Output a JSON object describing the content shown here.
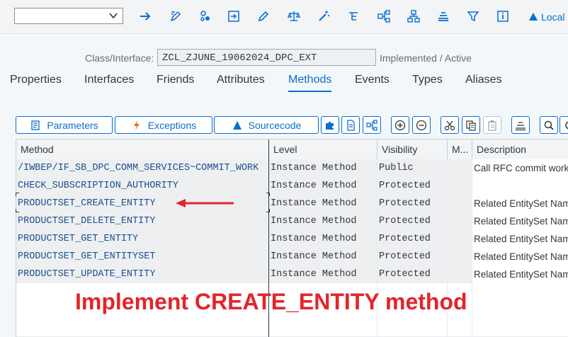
{
  "toolbar": {
    "combo_value": "",
    "icons": [
      "arrow-right-icon",
      "edit-display-icon",
      "object-list-icon",
      "where-used-icon",
      "pencil-icon",
      "balance-icon",
      "magic-wand-icon",
      "hierarchy-icon",
      "flow-icon",
      "org-chart-icon",
      "stack-icon",
      "filter-icon",
      "info-icon"
    ],
    "local_label": "Local"
  },
  "class_interface": {
    "label": "Class/Interface:",
    "value": "ZCL_ZJUNE_19062024_DPC_EXT",
    "status": "Implemented / Active"
  },
  "tabs": [
    {
      "label": "Properties",
      "active": false
    },
    {
      "label": "Interfaces",
      "active": false
    },
    {
      "label": "Friends",
      "active": false
    },
    {
      "label": "Attributes",
      "active": false
    },
    {
      "label": "Methods",
      "active": true
    },
    {
      "label": "Events",
      "active": false
    },
    {
      "label": "Types",
      "active": false
    },
    {
      "label": "Aliases",
      "active": false
    }
  ],
  "method_toolbar": {
    "parameters": "Parameters",
    "exceptions": "Exceptions",
    "sourcecode": "Sourcecode"
  },
  "grid": {
    "headers": {
      "method": "Method",
      "level": "Level",
      "visibility": "Visibility",
      "m": "M...",
      "description": "Description"
    },
    "rows": [
      {
        "method": "/IWBEP/IF_SB_DPC_COMM_SERVICES~COMMIT_WORK",
        "level": "Instance Method",
        "visibility": "Public",
        "description": "Call RFC commit work"
      },
      {
        "method": "CHECK_SUBSCRIPTION_AUTHORITY",
        "level": "Instance Method",
        "visibility": "Protected",
        "description": ""
      },
      {
        "method": "PRODUCTSET_CREATE_ENTITY",
        "level": "Instance Method",
        "visibility": "Protected",
        "description": "Related EntitySet Name"
      },
      {
        "method": "PRODUCTSET_DELETE_ENTITY",
        "level": "Instance Method",
        "visibility": "Protected",
        "description": "Related EntitySet Name"
      },
      {
        "method": "PRODUCTSET_GET_ENTITY",
        "level": "Instance Method",
        "visibility": "Protected",
        "description": "Related EntitySet Name"
      },
      {
        "method": "PRODUCTSET_GET_ENTITYSET",
        "level": "Instance Method",
        "visibility": "Protected",
        "description": "Related EntitySet Name"
      },
      {
        "method": "PRODUCTSET_UPDATE_ENTITY",
        "level": "Instance Method",
        "visibility": "Protected",
        "description": "Related EntitySet Name"
      }
    ]
  },
  "annotation": {
    "text": "Implement CREATE_ENTITY method",
    "color": "#e3242b"
  },
  "colors": {
    "accent": "#0a6ed1",
    "annotation": "#e3242b"
  }
}
